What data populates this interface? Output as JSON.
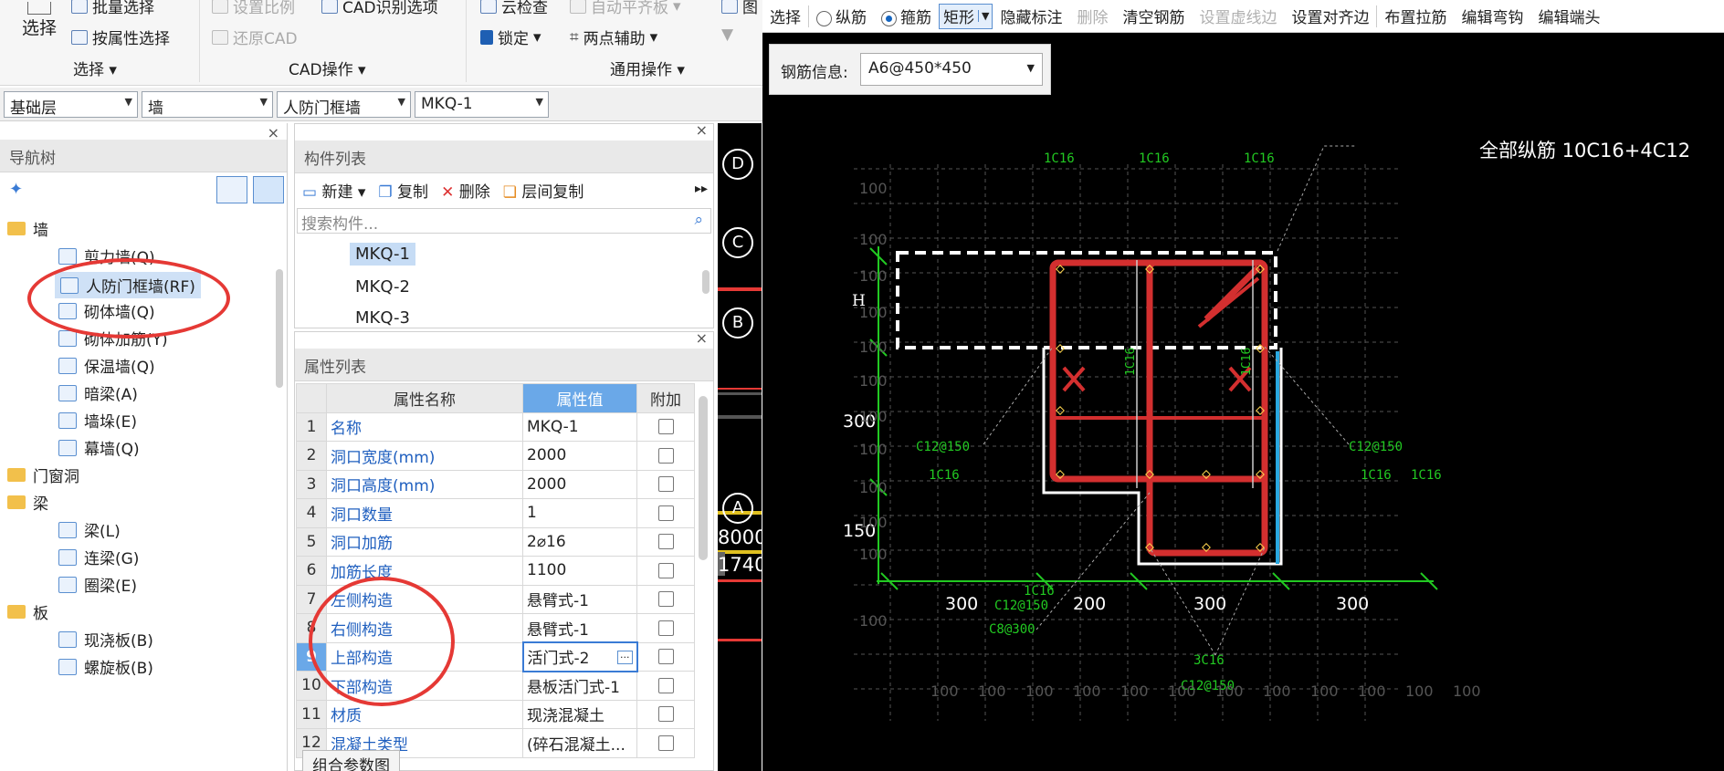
{
  "ribbon": {
    "select_big": "选择",
    "batch_select": "批量选择",
    "attr_select": "按属性选择",
    "set_scale": "设置比例",
    "restore_cad": "还原CAD",
    "cad_recognize": "CAD识别选项",
    "cloud_check": "云检查",
    "auto_align": "自动平齐板",
    "lock": "锁定",
    "two_point_aux": "两点辅助",
    "figure": "图",
    "group_select": "选择",
    "group_cad": "CAD操作",
    "group_general": "通用操作"
  },
  "combos": {
    "floor": "基础层",
    "type": "墙",
    "subtype": "人防门框墙",
    "component": "MKQ-1"
  },
  "nav": {
    "title": "导航树",
    "items": [
      {
        "label": "墙",
        "kind": "folder"
      },
      {
        "label": "剪力墙(Q)",
        "kind": "item"
      },
      {
        "label": "人防门框墙(RF)",
        "kind": "item"
      },
      {
        "label": "砌体墙(Q)",
        "kind": "item"
      },
      {
        "label": "砌体加筋(Y)",
        "kind": "item"
      },
      {
        "label": "保温墙(Q)",
        "kind": "item"
      },
      {
        "label": "暗梁(A)",
        "kind": "item"
      },
      {
        "label": "墙垛(E)",
        "kind": "item"
      },
      {
        "label": "幕墙(Q)",
        "kind": "item"
      },
      {
        "label": "门窗洞",
        "kind": "folder"
      },
      {
        "label": "梁",
        "kind": "folder"
      },
      {
        "label": "梁(L)",
        "kind": "item"
      },
      {
        "label": "连梁(G)",
        "kind": "item"
      },
      {
        "label": "圈梁(E)",
        "kind": "item"
      },
      {
        "label": "板",
        "kind": "folder"
      },
      {
        "label": "现浇板(B)",
        "kind": "item"
      },
      {
        "label": "螺旋板(B)",
        "kind": "item"
      }
    ]
  },
  "comp_list": {
    "title": "构件列表",
    "new": "新建",
    "copy": "复制",
    "delete": "删除",
    "floor_copy": "层间复制",
    "search_placeholder": "搜索构件...",
    "items": [
      "MKQ-1",
      "MKQ-2",
      "MKQ-3"
    ]
  },
  "props": {
    "title": "属性列表",
    "col_name": "属性名称",
    "col_value": "属性值",
    "col_extra": "附加",
    "rows": [
      {
        "n": "1",
        "name": "名称",
        "value": "MKQ-1"
      },
      {
        "n": "2",
        "name": "洞口宽度(mm)",
        "value": "2000"
      },
      {
        "n": "3",
        "name": "洞口高度(mm)",
        "value": "2000"
      },
      {
        "n": "4",
        "name": "洞口数量",
        "value": "1"
      },
      {
        "n": "5",
        "name": "洞口加筋",
        "value": "2⌀16"
      },
      {
        "n": "6",
        "name": "加筋长度",
        "value": "1100"
      },
      {
        "n": "7",
        "name": "左侧构造",
        "value": "悬臂式-1"
      },
      {
        "n": "8",
        "name": "右侧构造",
        "value": "悬臂式-1"
      },
      {
        "n": "9",
        "name": "上部构造",
        "value": "活门式-2"
      },
      {
        "n": "10",
        "name": "下部构造",
        "value": "悬板活门式-1"
      },
      {
        "n": "11",
        "name": "材质",
        "value": "现浇混凝土"
      },
      {
        "n": "12",
        "name": "混凝土类型",
        "value": "(碎石混凝土..."
      }
    ],
    "footer_tab": "组合参数图"
  },
  "strip": {
    "axes": [
      "D",
      "C",
      "B",
      "A"
    ],
    "dims": [
      "8000",
      "1740"
    ]
  },
  "cad_toolbar": {
    "select": "选择",
    "longitudinal": "纵筋",
    "stirrup": "箍筋",
    "shape": "矩形",
    "hide_label": "隐藏标注",
    "delete": "删除",
    "clear_rebar": "清空钢筋",
    "set_virtual": "设置虚线边",
    "set_align": "设置对齐边",
    "place_tie": "布置拉筋",
    "edit_hook": "编辑弯钩",
    "edit_end": "编辑端头"
  },
  "rebar_info": {
    "label": "钢筋信息:",
    "value": "A6@450*450"
  },
  "drawing": {
    "total_label": "全部纵筋 10C16+4C12",
    "top_labels": [
      "1C16",
      "1C16",
      "1C16"
    ],
    "left_h": "H",
    "dim_300": "300",
    "dim_150": "150",
    "grid_100": "100",
    "c12_150_left": "C12@150",
    "c16_left": "1C16",
    "c12_150_right": "C12@150",
    "c16_right_a": "1C16",
    "c16_right_b": "1C16",
    "bottom_dims": [
      "300",
      "200",
      "300",
      "300"
    ],
    "b_1c16": "1C16",
    "b_c12_150": "C12@150",
    "b_c8_300": "C8@300",
    "b_3c16": "3C16",
    "b_c12_150_b": "C12@150",
    "v_1c16a": "1C16",
    "v_1c16b": "1C16"
  }
}
